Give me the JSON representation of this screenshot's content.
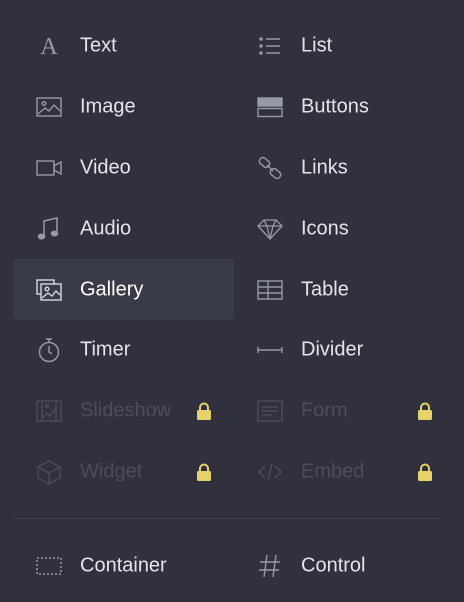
{
  "colors": {
    "background": "#30313d",
    "selected_background": "#3a3b48",
    "label": "#e4e5ea",
    "disabled_label": "#4c4d5a",
    "icon": "#9899a6",
    "disabled_icon": "#4c4d5a",
    "lock": "#e6d26a",
    "divider": "#41424e"
  },
  "elements": [
    {
      "label": "Text",
      "icon": "text-icon",
      "selected": false,
      "locked": false
    },
    {
      "label": "List",
      "icon": "list-icon",
      "selected": false,
      "locked": false
    },
    {
      "label": "Image",
      "icon": "image-icon",
      "selected": false,
      "locked": false
    },
    {
      "label": "Buttons",
      "icon": "buttons-icon",
      "selected": false,
      "locked": false
    },
    {
      "label": "Video",
      "icon": "video-icon",
      "selected": false,
      "locked": false
    },
    {
      "label": "Links",
      "icon": "link-icon",
      "selected": false,
      "locked": false
    },
    {
      "label": "Audio",
      "icon": "music-note-icon",
      "selected": false,
      "locked": false
    },
    {
      "label": "Icons",
      "icon": "diamond-icon",
      "selected": false,
      "locked": false
    },
    {
      "label": "Gallery",
      "icon": "gallery-icon",
      "selected": true,
      "locked": false
    },
    {
      "label": "Table",
      "icon": "table-icon",
      "selected": false,
      "locked": false
    },
    {
      "label": "Timer",
      "icon": "stopwatch-icon",
      "selected": false,
      "locked": false
    },
    {
      "label": "Divider",
      "icon": "divider-icon",
      "selected": false,
      "locked": false
    },
    {
      "label": "Slideshow",
      "icon": "slideshow-icon",
      "selected": false,
      "locked": true
    },
    {
      "label": "Form",
      "icon": "form-icon",
      "selected": false,
      "locked": true
    },
    {
      "label": "Widget",
      "icon": "cube-icon",
      "selected": false,
      "locked": true
    },
    {
      "label": "Embed",
      "icon": "code-icon",
      "selected": false,
      "locked": true
    }
  ],
  "layout_elements": [
    {
      "label": "Container",
      "icon": "container-icon",
      "selected": false,
      "locked": false
    },
    {
      "label": "Control",
      "icon": "hash-icon",
      "selected": false,
      "locked": false
    }
  ]
}
